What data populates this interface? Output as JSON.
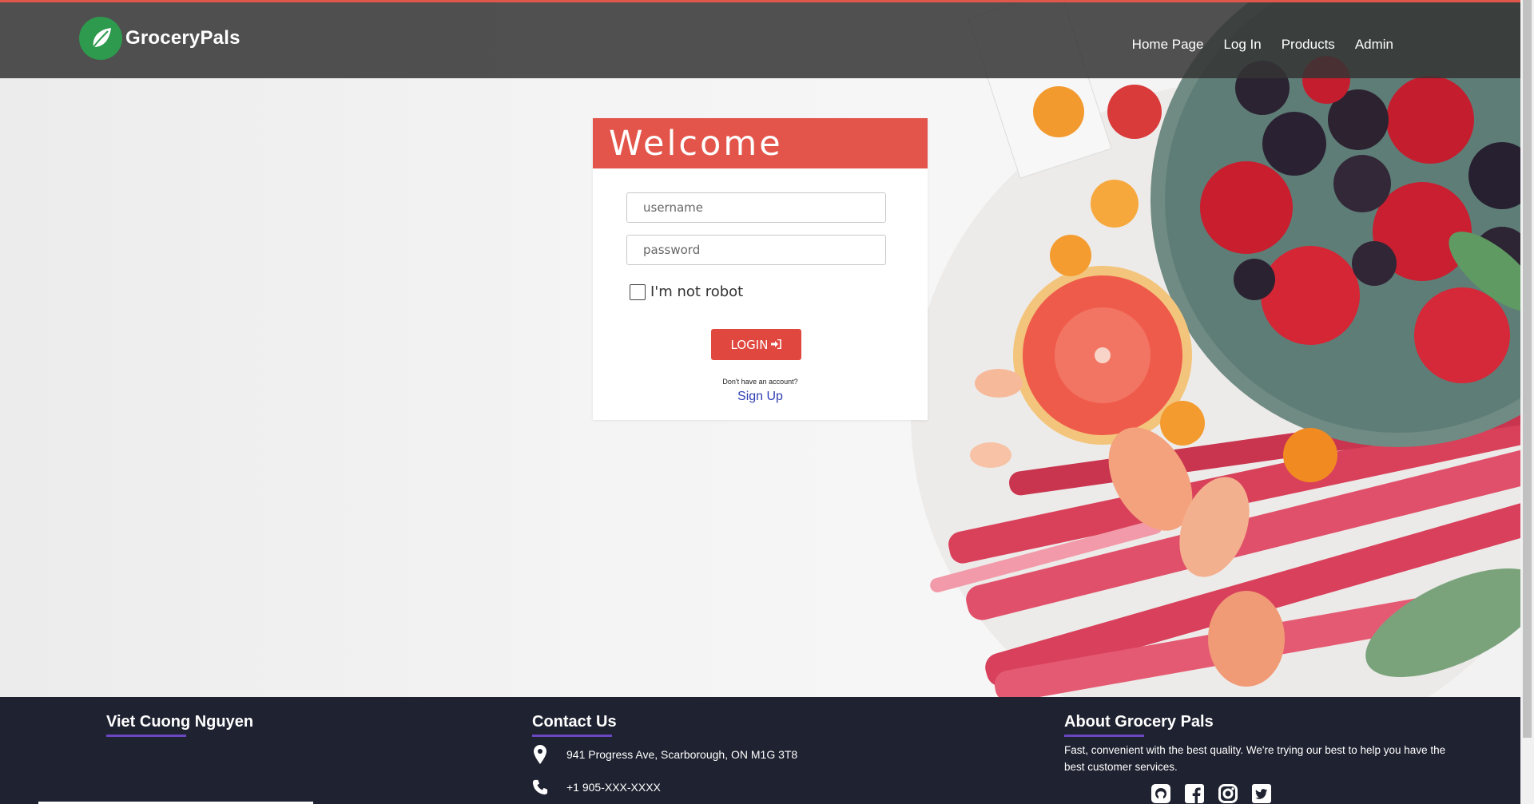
{
  "brand": {
    "name": "GroceryPals",
    "logo_icon": "leaf-icon",
    "logo_color": "#2e9a4d"
  },
  "nav": {
    "items": [
      {
        "label": "Home Page"
      },
      {
        "label": "Log In"
      },
      {
        "label": "Products"
      },
      {
        "label": "Admin"
      }
    ]
  },
  "login": {
    "title": "Welcome",
    "username_placeholder": "username",
    "password_placeholder": "password",
    "robot_label": "I'm not robot",
    "robot_checked": false,
    "button_label": "LOGIN",
    "button_icon": "sign-in-icon",
    "no_account_text": "Don't have an account?",
    "signup_label": "Sign Up",
    "accent_color": "#e3554a"
  },
  "footer": {
    "col1_title": "Viet Cuong Nguyen",
    "col2_title": "Contact Us",
    "address": "941 Progress Ave, Scarborough, ON M1G 3T8",
    "phone": "+1 905-XXX-XXXX",
    "col3_title": "About Grocery Pals",
    "about_text": "Fast, convenient with the best quality. We're trying our best to help you have the best customer services.",
    "socials": [
      "github-icon",
      "facebook-icon",
      "instagram-icon",
      "twitter-icon"
    ],
    "underline_color": "#6b46c1",
    "background": "#1f2230"
  }
}
